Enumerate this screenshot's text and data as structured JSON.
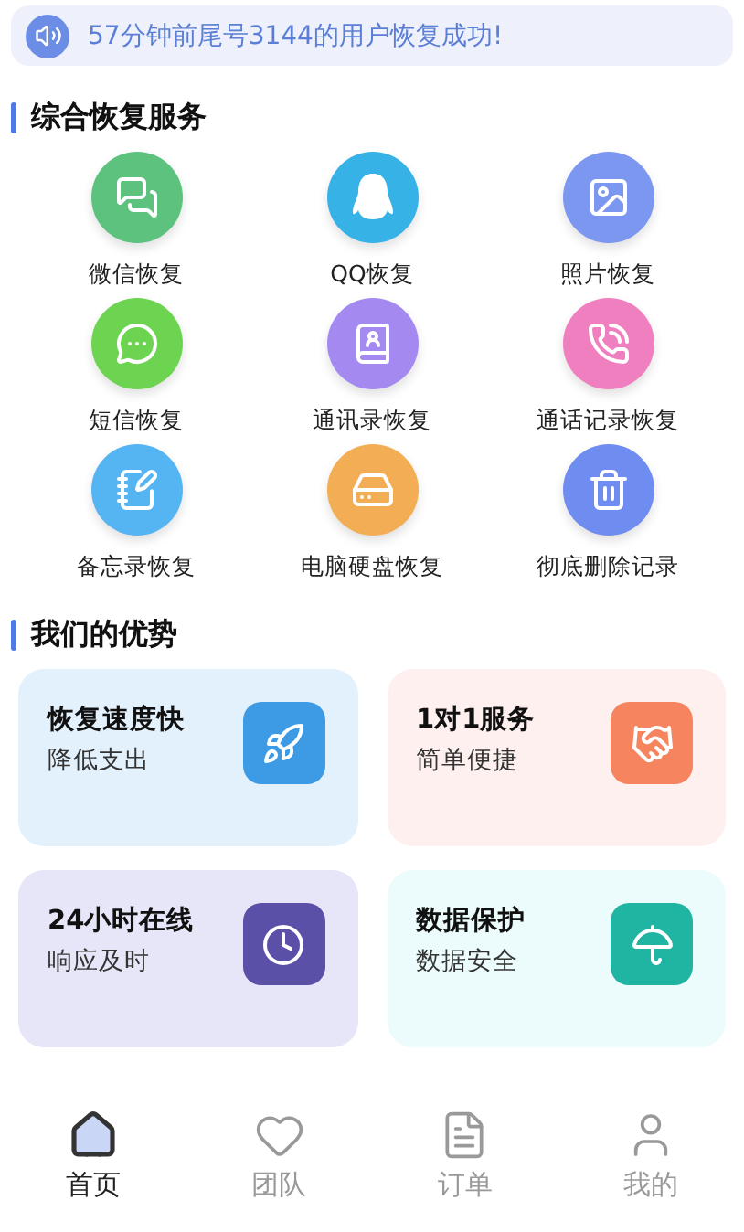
{
  "notice": {
    "text": "57分钟前尾号3144的用户恢复成功!"
  },
  "services": {
    "title": "综合恢复服务",
    "items": [
      {
        "label": "微信恢复",
        "kind": "wechat",
        "color": "#5cc27e"
      },
      {
        "label": "QQ恢复",
        "kind": "qq",
        "color": "#36b2e6"
      },
      {
        "label": "照片恢复",
        "kind": "photo",
        "color": "#7c97f0"
      },
      {
        "label": "短信恢复",
        "kind": "sms",
        "color": "#6cd451"
      },
      {
        "label": "通讯录恢复",
        "kind": "contacts",
        "color": "#a48af0"
      },
      {
        "label": "通话记录恢复",
        "kind": "calls",
        "color": "#ef7fbf"
      },
      {
        "label": "备忘录恢复",
        "kind": "memo",
        "color": "#55b4f2"
      },
      {
        "label": "电脑硬盘恢复",
        "kind": "disk",
        "color": "#f2ad55"
      },
      {
        "label": "彻底删除记录",
        "kind": "trash",
        "color": "#6f8cf0"
      }
    ]
  },
  "advantages": {
    "title": "我们的优势",
    "cards": [
      {
        "title": "恢复速度快",
        "subtitle": "降低支出",
        "kind": "rocket",
        "color": "#3d9be6"
      },
      {
        "title": "1对1服务",
        "subtitle": "简单便捷",
        "kind": "handshake",
        "color": "#f5845f"
      },
      {
        "title": "24小时在线",
        "subtitle": "响应及时",
        "kind": "clock",
        "color": "#5a50a8"
      },
      {
        "title": "数据保护",
        "subtitle": "数据安全",
        "kind": "umbrella",
        "color": "#20b5a3"
      }
    ]
  },
  "tabs": [
    {
      "label": "首页",
      "kind": "home",
      "selected": true
    },
    {
      "label": "团队",
      "kind": "team",
      "selected": false
    },
    {
      "label": "订单",
      "kind": "orders",
      "selected": false
    },
    {
      "label": "我的",
      "kind": "me",
      "selected": false
    }
  ]
}
